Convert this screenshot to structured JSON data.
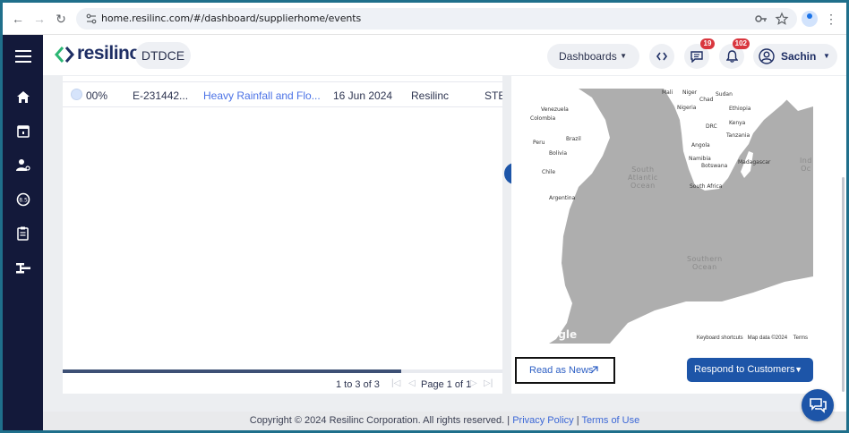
{
  "browser": {
    "url": "home.resilinc.com/#/dashboard/supplierhome/events",
    "back": "←",
    "forward": "→",
    "reload": "↻"
  },
  "header": {
    "logo_text": "resilinc",
    "tenant": "DTDCE",
    "dashboards_label": "Dashboards",
    "messages_count": "19",
    "notifications_count": "102",
    "user_name": "Sachin"
  },
  "table": {
    "row": {
      "progress": "00%",
      "event_id": "E-231442...",
      "event_name": "Heavy Rainfall and Flo...",
      "date": "16 Jun 2024",
      "source": "Resilinc",
      "status": "STE"
    },
    "pager_range": "1 to 3 of 3",
    "pager_page": "Page 1 of 1"
  },
  "map": {
    "countries": [
      "Mali",
      "Niger",
      "Chad",
      "Sudan",
      "Venezuela",
      "Colombia",
      "Nigeria",
      "Ethiopia",
      "Brazil",
      "DRC",
      "Kenya",
      "Tanzania",
      "Peru",
      "Bolivia",
      "Angola",
      "Chile",
      "Namibia",
      "Botswana",
      "Madagascar",
      "South Africa",
      "Argentina"
    ],
    "ocean_south_atlantic": "South\nAtlantic\nOcean",
    "ocean_southern": "Southern\nOcean",
    "ocean_indian": "Ind\nOc",
    "google": "Google",
    "keyboard_shortcuts": "Keyboard shortcuts",
    "map_data": "Map data ©2024",
    "terms": "Terms"
  },
  "actions": {
    "read_news": "Read as News",
    "respond": "Respond to Customers"
  },
  "footer": {
    "copyright": "Copyright © 2024 Resilinc Corporation. All rights reserved. |",
    "privacy": "Privacy Policy",
    "sep": "|",
    "terms": "Terms of Use"
  },
  "colors": {
    "sidebar": "#13193a",
    "primary": "#1d55a8",
    "link": "#4b72e6",
    "badge": "#d9363e"
  }
}
